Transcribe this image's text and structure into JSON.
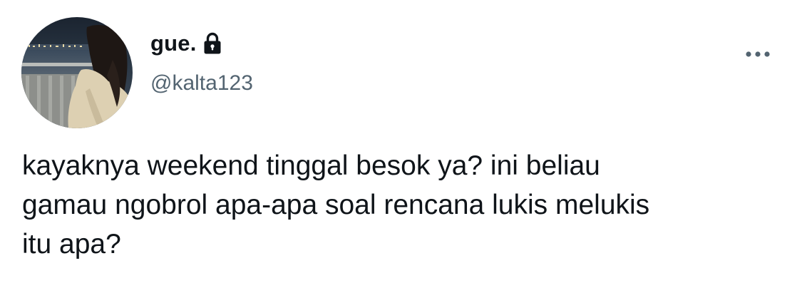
{
  "author": {
    "display_name": "gue.",
    "handle": "@kalta123",
    "protected_icon": "lock-icon",
    "avatar": "profile-photo"
  },
  "actions": {
    "more_icon": "more-horizontal-icon"
  },
  "tweet": {
    "lines": [
      "kayaknya weekend tinggal besok ya? ini beliau",
      "gamau ngobrol apa-apa soal rencana lukis melukis",
      "itu apa?"
    ]
  },
  "colors": {
    "text_primary": "#0f1419",
    "text_secondary": "#536471",
    "background": "#ffffff"
  }
}
